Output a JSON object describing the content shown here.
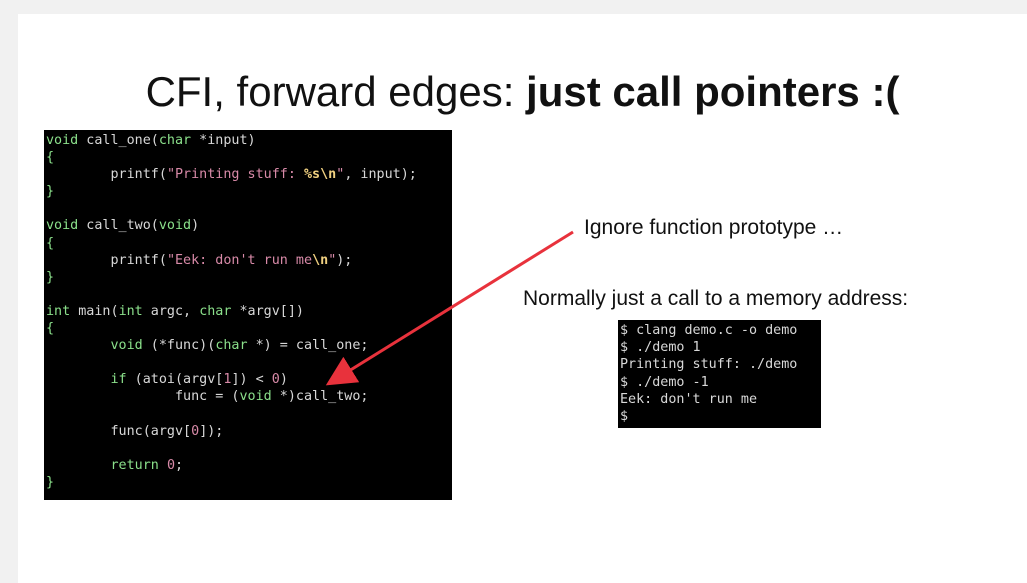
{
  "slide": {
    "title_plain": "CFI, forward edges: ",
    "title_bold": "just call pointers :(",
    "note_prototype": "Ignore function prototype …",
    "note_memory": "Normally just a call to a memory address:"
  },
  "code_panel": {
    "lines": [
      "void call_one(char *input)",
      "{",
      "        printf(\"Printing stuff: %s\\n\", input);",
      "}",
      "",
      "void call_two(void)",
      "{",
      "        printf(\"Eek: don't run me\\n\");",
      "}",
      "",
      "int main(int argc, char *argv[])",
      "{",
      "        void (*func)(char *) = call_one;",
      "",
      "        if (atoi(argv[1]) < 0)",
      "                func = (void *)call_two;",
      "",
      "        func(argv[0]);",
      "",
      "        return 0;",
      "}"
    ]
  },
  "terminal": {
    "lines": [
      "$ clang demo.c -o demo",
      "$ ./demo 1",
      "Printing stuff: ./demo",
      "$ ./demo -1",
      "Eek: don't run me",
      "$"
    ]
  },
  "colors": {
    "arrow": "#e8323c",
    "keyword": "#8be08b",
    "string": "#d88aa8"
  }
}
